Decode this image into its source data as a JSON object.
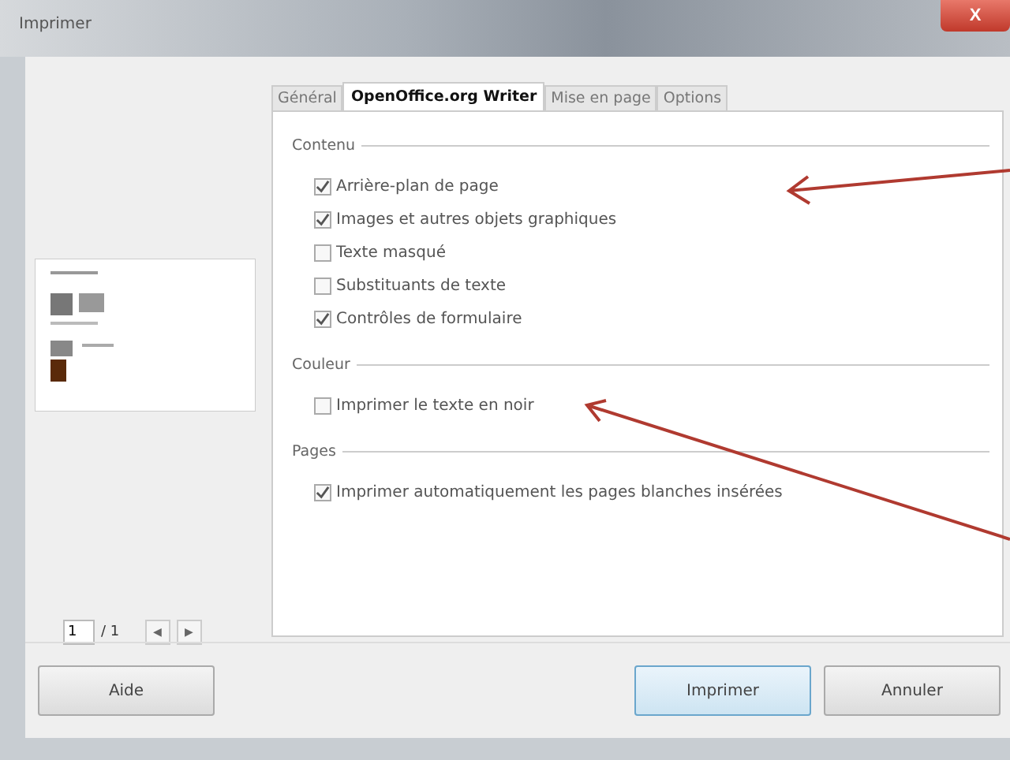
{
  "window": {
    "title": "Imprimer",
    "close": "X"
  },
  "tabs": [
    {
      "label": "Général",
      "selected": false
    },
    {
      "label": "OpenOffice.org Writer",
      "selected": true
    },
    {
      "label": "Mise en page",
      "selected": false
    },
    {
      "label": "Options",
      "selected": false
    }
  ],
  "sections": [
    {
      "title": "Contenu",
      "options": [
        {
          "label": "Arrière-plan de page",
          "checked": true
        },
        {
          "label": "Images et autres objets graphiques",
          "checked": true
        },
        {
          "label": "Texte masqué",
          "checked": false
        },
        {
          "label": "Substituants de texte",
          "checked": false
        },
        {
          "label": "Contrôles de formulaire",
          "checked": true
        }
      ]
    },
    {
      "title": "Couleur",
      "options": [
        {
          "label": "Imprimer le texte en noir",
          "checked": false
        }
      ]
    },
    {
      "title": "Pages",
      "options": [
        {
          "label": "Imprimer automatiquement les pages blanches insérées",
          "checked": true
        }
      ]
    }
  ],
  "preview": {
    "page": "1",
    "total": "/ 1",
    "prev": "◀",
    "next": "▶"
  },
  "buttons": {
    "help": "Aide",
    "print": "Imprimer",
    "cancel": "Annuler"
  }
}
